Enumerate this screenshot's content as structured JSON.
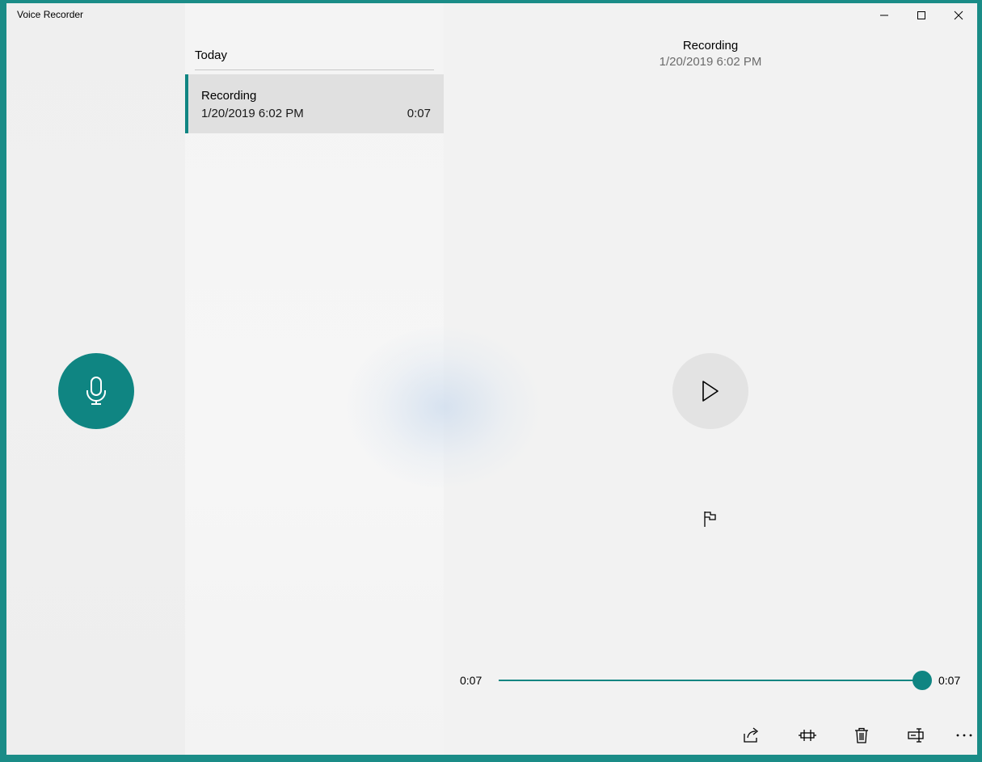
{
  "window": {
    "title": "Voice Recorder"
  },
  "recordings": {
    "group_header": "Today",
    "items": [
      {
        "name": "Recording",
        "date": "1/20/2019 6:02 PM",
        "duration": "0:07"
      }
    ]
  },
  "detail": {
    "title": "Recording",
    "date": "1/20/2019 6:02 PM",
    "time_current": "0:07",
    "time_total": "0:07",
    "progress_percent": 100
  },
  "icons": {
    "record": "microphone-icon",
    "play": "play-icon",
    "marker": "flag-icon",
    "share": "share-icon",
    "trim": "trim-icon",
    "delete": "delete-icon",
    "rename": "rename-icon",
    "more": "more-icon"
  },
  "colors": {
    "accent": "#0f8582",
    "border": "#1a8c87"
  }
}
